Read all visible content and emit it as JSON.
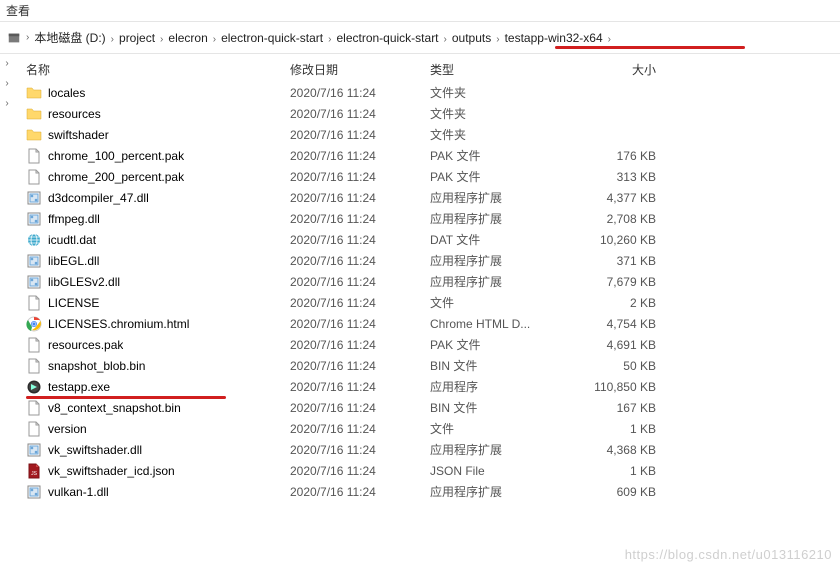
{
  "menu_fragment": "查看",
  "breadcrumbs": [
    "本地磁盘 (D:)",
    "project",
    "elecron",
    "electron-quick-start",
    "electron-quick-start",
    "outputs",
    "testapp-win32-x64"
  ],
  "columns": {
    "name": "名称",
    "date": "修改日期",
    "type": "类型",
    "size": "大小"
  },
  "files": [
    {
      "icon": "folder",
      "name": "locales",
      "date": "2020/7/16 11:24",
      "type": "文件夹",
      "size": ""
    },
    {
      "icon": "folder",
      "name": "resources",
      "date": "2020/7/16 11:24",
      "type": "文件夹",
      "size": ""
    },
    {
      "icon": "folder",
      "name": "swiftshader",
      "date": "2020/7/16 11:24",
      "type": "文件夹",
      "size": ""
    },
    {
      "icon": "file",
      "name": "chrome_100_percent.pak",
      "date": "2020/7/16 11:24",
      "type": "PAK 文件",
      "size": "176 KB"
    },
    {
      "icon": "file",
      "name": "chrome_200_percent.pak",
      "date": "2020/7/16 11:24",
      "type": "PAK 文件",
      "size": "313 KB"
    },
    {
      "icon": "dll",
      "name": "d3dcompiler_47.dll",
      "date": "2020/7/16 11:24",
      "type": "应用程序扩展",
      "size": "4,377 KB"
    },
    {
      "icon": "dll",
      "name": "ffmpeg.dll",
      "date": "2020/7/16 11:24",
      "type": "应用程序扩展",
      "size": "2,708 KB"
    },
    {
      "icon": "globe",
      "name": "icudtl.dat",
      "date": "2020/7/16 11:24",
      "type": "DAT 文件",
      "size": "10,260 KB"
    },
    {
      "icon": "dll",
      "name": "libEGL.dll",
      "date": "2020/7/16 11:24",
      "type": "应用程序扩展",
      "size": "371 KB"
    },
    {
      "icon": "dll",
      "name": "libGLESv2.dll",
      "date": "2020/7/16 11:24",
      "type": "应用程序扩展",
      "size": "7,679 KB"
    },
    {
      "icon": "file",
      "name": "LICENSE",
      "date": "2020/7/16 11:24",
      "type": "文件",
      "size": "2 KB"
    },
    {
      "icon": "chrome",
      "name": "LICENSES.chromium.html",
      "date": "2020/7/16 11:24",
      "type": "Chrome HTML D...",
      "size": "4,754 KB"
    },
    {
      "icon": "file",
      "name": "resources.pak",
      "date": "2020/7/16 11:24",
      "type": "PAK 文件",
      "size": "4,691 KB"
    },
    {
      "icon": "file",
      "name": "snapshot_blob.bin",
      "date": "2020/7/16 11:24",
      "type": "BIN 文件",
      "size": "50 KB"
    },
    {
      "icon": "exe",
      "name": "testapp.exe",
      "date": "2020/7/16 11:24",
      "type": "应用程序",
      "size": "110,850 KB",
      "highlight": true
    },
    {
      "icon": "file",
      "name": "v8_context_snapshot.bin",
      "date": "2020/7/16 11:24",
      "type": "BIN 文件",
      "size": "167 KB"
    },
    {
      "icon": "file",
      "name": "version",
      "date": "2020/7/16 11:24",
      "type": "文件",
      "size": "1 KB"
    },
    {
      "icon": "dll",
      "name": "vk_swiftshader.dll",
      "date": "2020/7/16 11:24",
      "type": "应用程序扩展",
      "size": "4,368 KB"
    },
    {
      "icon": "json",
      "name": "vk_swiftshader_icd.json",
      "date": "2020/7/16 11:24",
      "type": "JSON File",
      "size": "1 KB"
    },
    {
      "icon": "dll",
      "name": "vulkan-1.dll",
      "date": "2020/7/16 11:24",
      "type": "应用程序扩展",
      "size": "609 KB"
    }
  ],
  "watermark": "https://blog.csdn.net/u013116210"
}
